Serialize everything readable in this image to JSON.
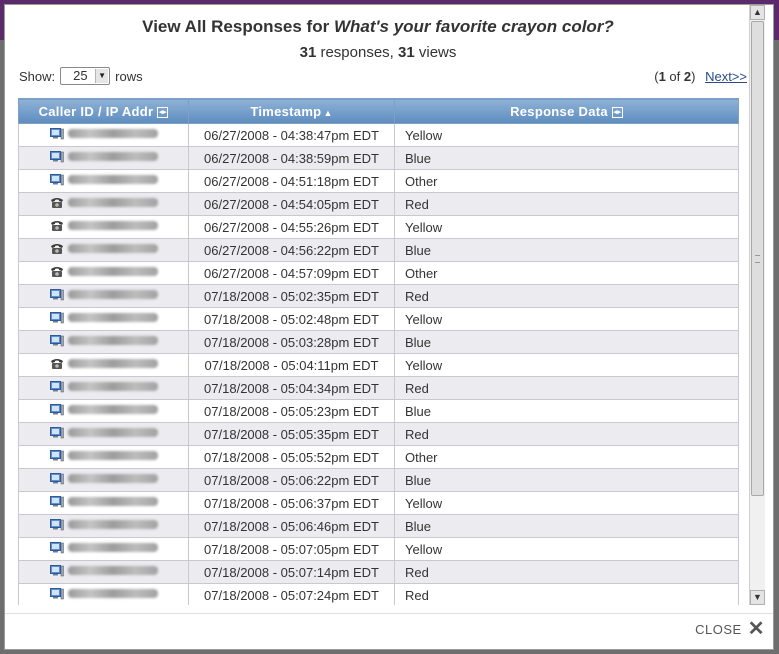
{
  "dialog": {
    "title_prefix": "View All Responses for ",
    "title_question": "What's your favorite crayon color?",
    "response_count": "31",
    "responses_label": " responses, ",
    "view_count": "31",
    "views_label": " views",
    "show_label": "Show:",
    "rows_per_page": "25",
    "rows_label": "rows",
    "pager": {
      "open": "(",
      "current": "1",
      "of": " of ",
      "total": "2",
      "close": ")",
      "next": "Next>>"
    },
    "close_label": "CLOSE"
  },
  "table": {
    "columns": [
      "Caller ID / IP Addr",
      "Timestamp",
      "Response Data"
    ],
    "sort_indicator": "▲",
    "rows": [
      {
        "source": "computer",
        "timestamp": "06/27/2008 - 04:38:47pm EDT",
        "response": "Yellow"
      },
      {
        "source": "computer",
        "timestamp": "06/27/2008 - 04:38:59pm EDT",
        "response": "Blue"
      },
      {
        "source": "computer",
        "timestamp": "06/27/2008 - 04:51:18pm EDT",
        "response": "Other"
      },
      {
        "source": "phone",
        "timestamp": "06/27/2008 - 04:54:05pm EDT",
        "response": "Red"
      },
      {
        "source": "phone",
        "timestamp": "06/27/2008 - 04:55:26pm EDT",
        "response": "Yellow"
      },
      {
        "source": "phone",
        "timestamp": "06/27/2008 - 04:56:22pm EDT",
        "response": "Blue"
      },
      {
        "source": "phone",
        "timestamp": "06/27/2008 - 04:57:09pm EDT",
        "response": "Other"
      },
      {
        "source": "computer",
        "timestamp": "07/18/2008 - 05:02:35pm EDT",
        "response": "Red"
      },
      {
        "source": "computer",
        "timestamp": "07/18/2008 - 05:02:48pm EDT",
        "response": "Yellow"
      },
      {
        "source": "computer",
        "timestamp": "07/18/2008 - 05:03:28pm EDT",
        "response": "Blue"
      },
      {
        "source": "phone",
        "timestamp": "07/18/2008 - 05:04:11pm EDT",
        "response": "Yellow"
      },
      {
        "source": "computer",
        "timestamp": "07/18/2008 - 05:04:34pm EDT",
        "response": "Red"
      },
      {
        "source": "computer",
        "timestamp": "07/18/2008 - 05:05:23pm EDT",
        "response": "Blue"
      },
      {
        "source": "computer",
        "timestamp": "07/18/2008 - 05:05:35pm EDT",
        "response": "Red"
      },
      {
        "source": "computer",
        "timestamp": "07/18/2008 - 05:05:52pm EDT",
        "response": "Other"
      },
      {
        "source": "computer",
        "timestamp": "07/18/2008 - 05:06:22pm EDT",
        "response": "Blue"
      },
      {
        "source": "computer",
        "timestamp": "07/18/2008 - 05:06:37pm EDT",
        "response": "Yellow"
      },
      {
        "source": "computer",
        "timestamp": "07/18/2008 - 05:06:46pm EDT",
        "response": "Blue"
      },
      {
        "source": "computer",
        "timestamp": "07/18/2008 - 05:07:05pm EDT",
        "response": "Yellow"
      },
      {
        "source": "computer",
        "timestamp": "07/18/2008 - 05:07:14pm EDT",
        "response": "Red"
      },
      {
        "source": "computer",
        "timestamp": "07/18/2008 - 05:07:24pm EDT",
        "response": "Red"
      }
    ]
  },
  "colors": {
    "header_top": "#8fb2d6",
    "header_bottom": "#5e8cbf",
    "row_alt": "#ececf0",
    "link": "#2a4a8a"
  }
}
